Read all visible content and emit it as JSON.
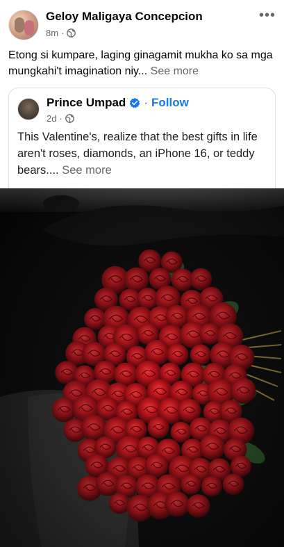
{
  "post": {
    "author": "Geloy Maligaya Concepcion",
    "time": "8m",
    "separator": "·",
    "more_icon": "more-horizontal-icon",
    "audience_icon": "globe-icon",
    "caption": "Etong si kumpare, laging ginagamit mukha ko sa mga mungkahi't imagination niy...",
    "see_more": "See more"
  },
  "shared_post": {
    "author": "Prince Umpad",
    "verified_icon": "verified-badge-icon",
    "separator": "·",
    "follow_label": "Follow",
    "time": "2d",
    "audience_icon": "globe-icon",
    "text": "This Valentine's, realize that the best gifts in life aren't roses, diamonds, an iPhone 16, or teddy bears....",
    "see_more": "See more"
  },
  "photo": {
    "subject": "bouquet-of-red-roses"
  },
  "colors": {
    "link_blue": "#1877f2",
    "secondary_text": "#65676b",
    "rose_red": "#b3121c"
  }
}
